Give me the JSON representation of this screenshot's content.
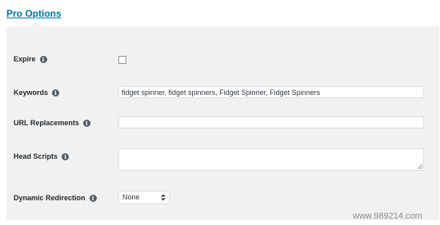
{
  "tab": {
    "label": "Pro Options"
  },
  "fields": {
    "expire": {
      "label": "Expire",
      "checked": false
    },
    "keywords": {
      "label": "Keywords",
      "value": "fidget spinner, fidget spinners, Fidget Spinner, Fidget Spinners"
    },
    "url_replacements": {
      "label": "URL Replacements",
      "value": ""
    },
    "head_scripts": {
      "label": "Head Scripts",
      "value": ""
    },
    "dynamic_redirection": {
      "label": "Dynamic Redirection",
      "selected": "None"
    }
  },
  "icons": {
    "info": "info-icon",
    "info_glyph": "i"
  },
  "watermark": "www.989214.com",
  "colors": {
    "link": "#0073aa",
    "panel": "#f1f1f1",
    "icon": "#555d66"
  }
}
